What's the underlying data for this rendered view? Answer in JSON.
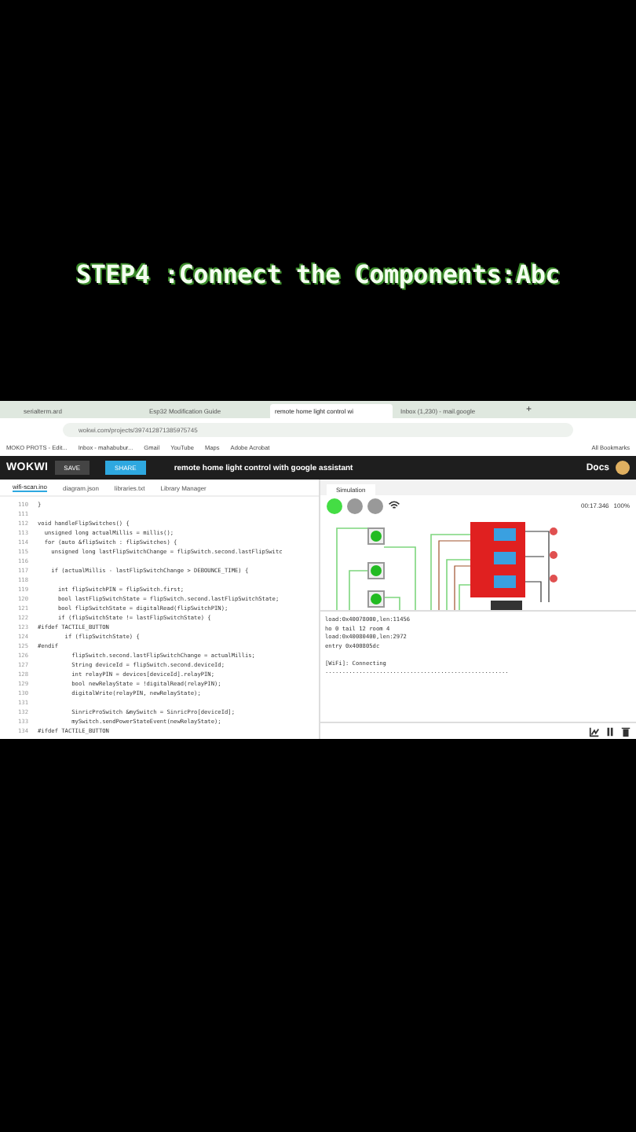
{
  "video_caption": "STEP4 :Connect the Components:Abc",
  "browser": {
    "tabs": [
      {
        "title": "serialterm.ard",
        "selected": false
      },
      {
        "title": "Esp32 Modification Guide",
        "selected": false
      },
      {
        "title": "remote home light control wi",
        "selected": true
      },
      {
        "title": "Inbox (1,230) - mail.google",
        "selected": false
      }
    ],
    "new_tab": "+",
    "address": "wokwi.com/projects/397412871385975745",
    "bookmarks": [
      "MOKO PROTS - Edit...",
      "Inbox - mahabubur...",
      "Gmail",
      "YouTube",
      "Maps",
      "Adobe Acrobat"
    ],
    "all_bookmarks": "All Bookmarks"
  },
  "wokwi": {
    "logo": "WOKWI",
    "save": "SAVE",
    "share": "SHARE",
    "project_title": "remote home light control with google assistant",
    "docs": "Docs"
  },
  "editor": {
    "tabs": [
      {
        "label": "wifi-scan.ino",
        "selected": true
      },
      {
        "label": "diagram.json",
        "selected": false
      },
      {
        "label": "libraries.txt",
        "selected": false
      },
      {
        "label": "Library Manager",
        "selected": false
      }
    ],
    "lines": [
      {
        "number": "110",
        "code": "}"
      },
      {
        "number": "111"
      },
      {
        "number": "112",
        "code": "void handleFlipSwitches() {"
      },
      {
        "number": "113",
        "code": "  unsigned long actualMillis = millis();"
      },
      {
        "number": "114",
        "code": "  for (auto &flipSwitch : flipSwitches) {"
      },
      {
        "number": "115",
        "code": "    unsigned long lastFlipSwitchChange = flipSwitch.second.lastFlipSwitc"
      },
      {
        "number": "116"
      },
      {
        "number": "117",
        "code": "    if (actualMillis - lastFlipSwitchChange > DEBOUNCE_TIME) {"
      },
      {
        "number": "118"
      },
      {
        "number": "119",
        "code": "      int flipSwitchPIN = flipSwitch.first;"
      },
      {
        "number": "120",
        "code": "      bool lastFlipSwitchState = flipSwitch.second.lastFlipSwitchState;"
      },
      {
        "number": "121",
        "code": "      bool flipSwitchState = digitalRead(flipSwitchPIN);"
      },
      {
        "number": "122",
        "code": "      if (flipSwitchState != lastFlipSwitchState) {"
      },
      {
        "number": "123",
        "code": "#ifdef TACTILE_BUTTON"
      },
      {
        "number": "124",
        "code": "        if (flipSwitchState) {"
      },
      {
        "number": "125",
        "code": "#endif"
      },
      {
        "number": "126",
        "code": "          flipSwitch.second.lastFlipSwitchChange = actualMillis;"
      },
      {
        "number": "127",
        "code": "          String deviceId = flipSwitch.second.deviceId;"
      },
      {
        "number": "128",
        "code": "          int relayPIN = devices[deviceId].relayPIN;"
      },
      {
        "number": "129",
        "code": "          bool newRelayState = !digitalRead(relayPIN);"
      },
      {
        "number": "130",
        "code": "          digitalWrite(relayPIN, newRelayState);"
      },
      {
        "number": "131"
      },
      {
        "number": "132",
        "code": "          SinricProSwitch &mySwitch = SinricPro[deviceId];"
      },
      {
        "number": "133",
        "code": "          mySwitch.sendPowerStateEvent(newRelayState);"
      },
      {
        "number": "134",
        "code": "#ifdef TACTILE_BUTTON"
      }
    ]
  },
  "simulation": {
    "tab": "Simulation",
    "timer": "00:17.346",
    "speed": "100%",
    "serial_output": [
      [
        "load:0x40078000,len:11456",
        "ho 0 tail 12 room 4",
        "load:0x40080400,len:2972",
        "entry 0x400805dc"
      ],
      [
        "[WiFi]: Connecting",
        "......................................................"
      ]
    ]
  }
}
